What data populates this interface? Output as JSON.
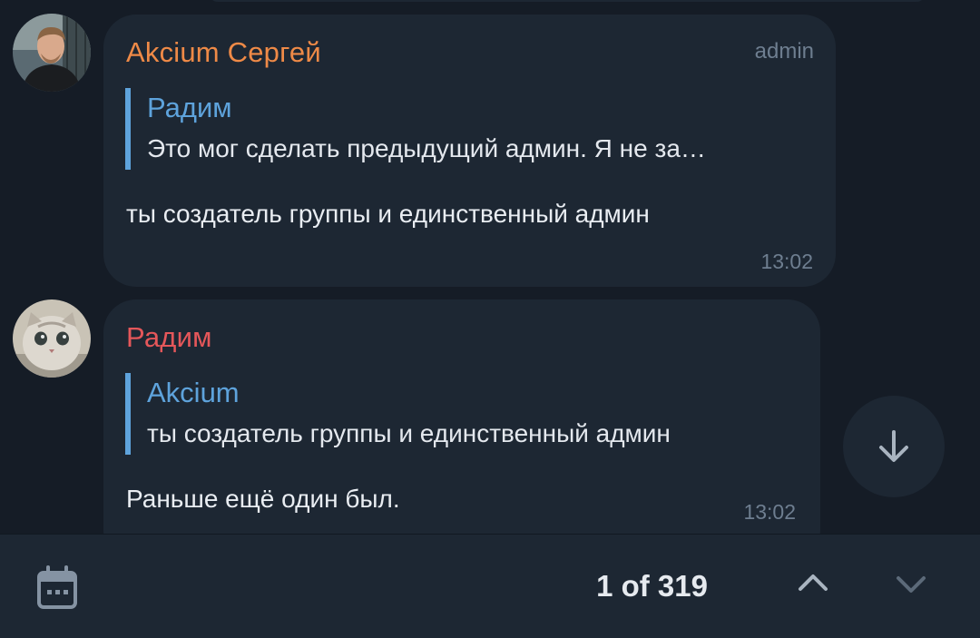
{
  "messages": [
    {
      "sender": "Akcium Сергей",
      "sender_color": "#ef8a47",
      "role": "admin",
      "reply": {
        "author": "Радим",
        "text": "Это мог сделать предыдущий админ. Я не за…"
      },
      "text": "ты создатель группы и единственный админ",
      "time": "13:02",
      "avatar": "user-photo-avatar"
    },
    {
      "sender": "Радим",
      "sender_color": "#e5575a",
      "reply": {
        "author": "Akcium",
        "text": "ты создатель группы и единственный админ"
      },
      "text": "Раньше ещё один был.",
      "time": "13:02",
      "avatar": "cat-photo-avatar"
    }
  ],
  "search_bar": {
    "counter": "1 of 319",
    "calendar_icon": "calendar-icon",
    "prev_icon": "chevron-up-icon",
    "next_icon": "chevron-down-icon"
  },
  "scroll_button_icon": "arrow-down-icon",
  "colors": {
    "background": "#151c26",
    "bubble": "#1d2733",
    "accent": "#5ea3dc"
  }
}
